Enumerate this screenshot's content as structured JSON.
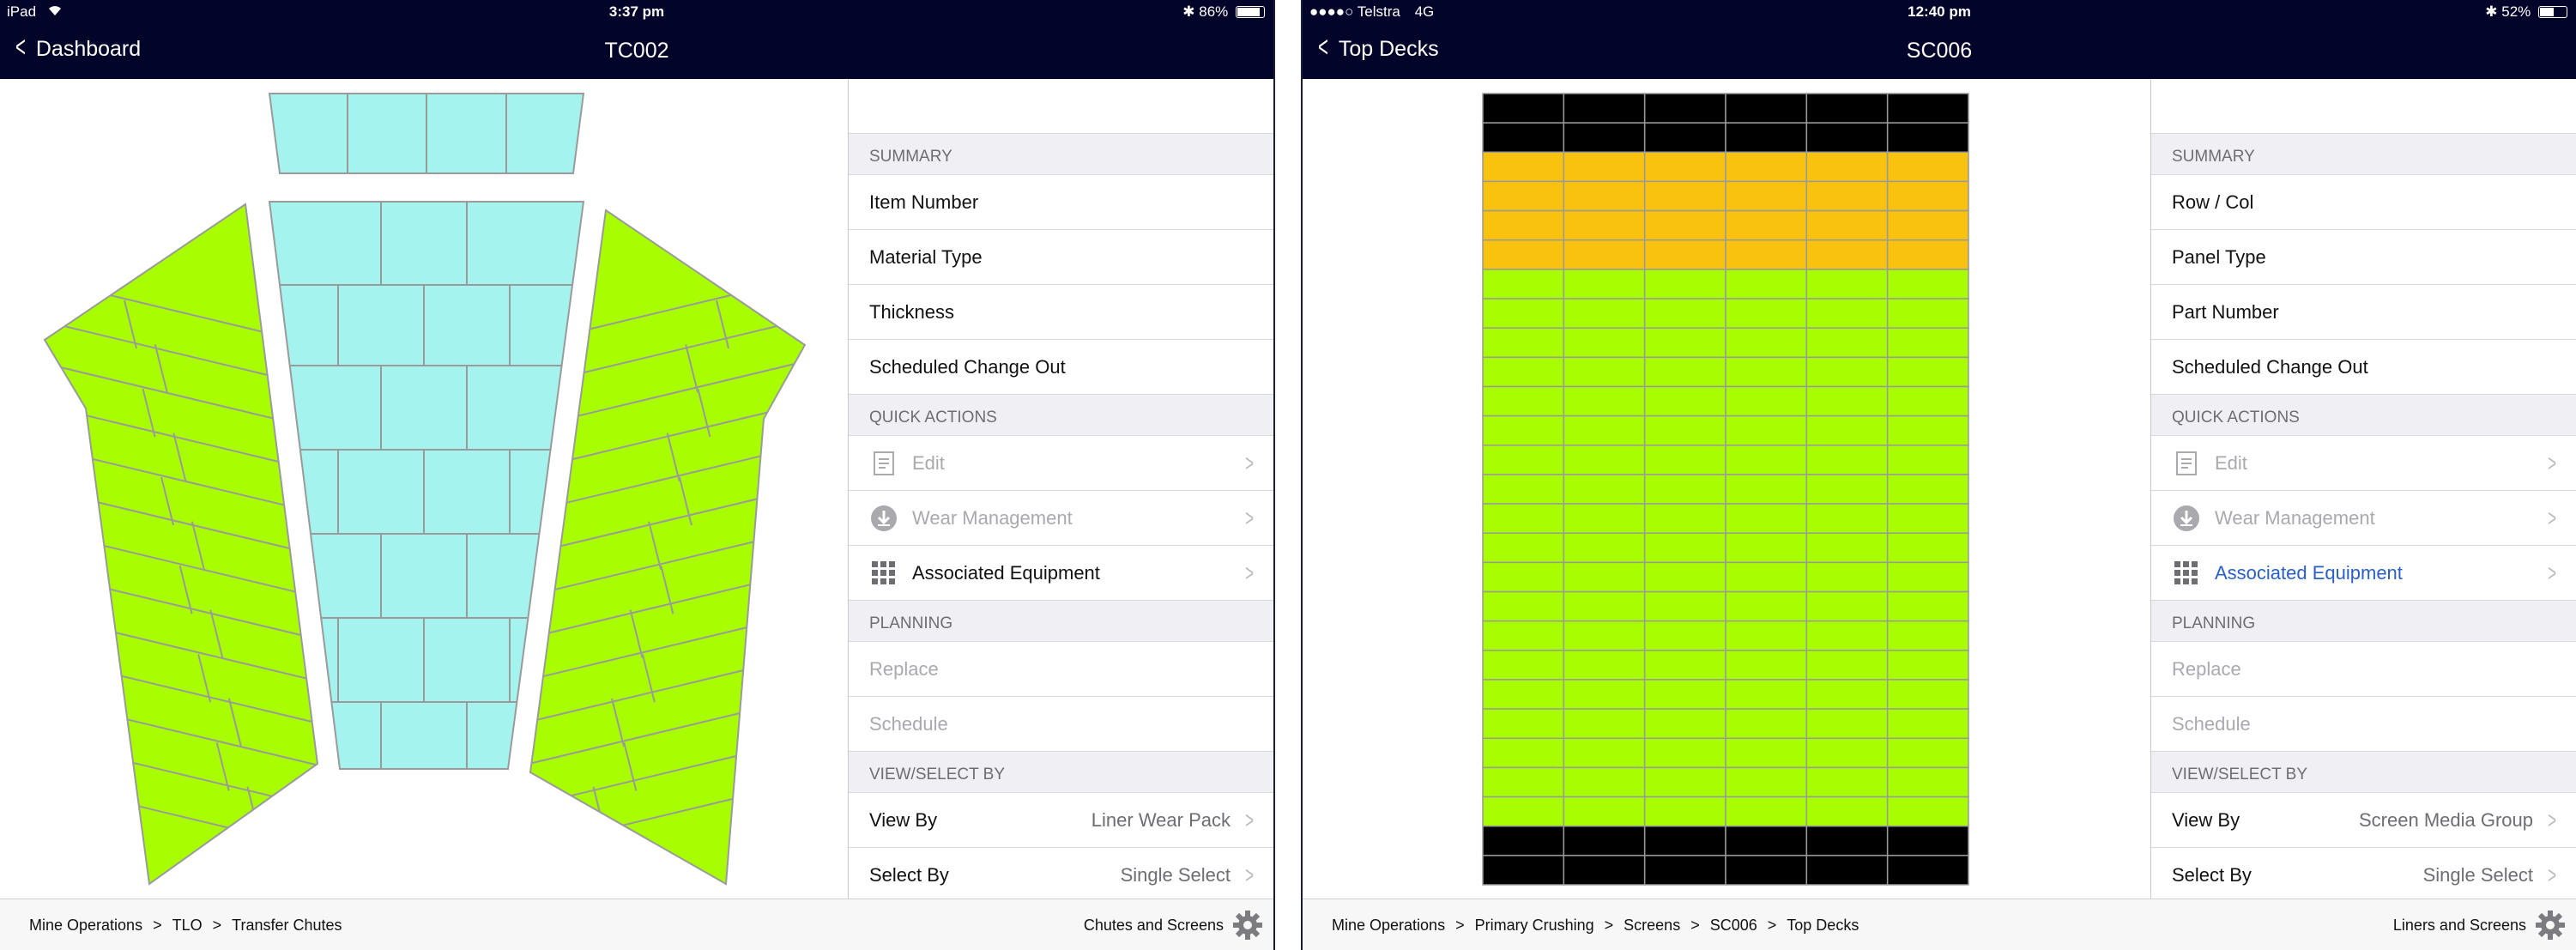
{
  "left": {
    "status": {
      "device": "iPad",
      "time": "3:37 pm",
      "battery": "86%",
      "battery_level": 0.86
    },
    "nav": {
      "back_label": "Dashboard",
      "title": "TC002"
    },
    "summary": {
      "header": "SUMMARY",
      "rows": [
        "Item Number",
        "Material Type",
        "Thickness",
        "Scheduled Change Out"
      ]
    },
    "quick_actions": {
      "header": "QUICK ACTIONS",
      "edit": "Edit",
      "wear": "Wear Management",
      "associated": "Associated Equipment"
    },
    "planning": {
      "header": "PLANNING",
      "replace": "Replace",
      "schedule": "Schedule"
    },
    "view_select": {
      "header": "VIEW/SELECT BY",
      "view_by_label": "View By",
      "view_by_value": "Liner Wear Pack",
      "select_by_label": "Select By",
      "select_by_value": "Single Select"
    },
    "footer": {
      "crumbs": [
        "Mine Operations",
        "TLO",
        "Transfer Chutes"
      ],
      "separator": ">",
      "context": "Chutes and Screens"
    },
    "colors": {
      "green": "#a8fd00",
      "cyan": "#a5f3ee"
    }
  },
  "right": {
    "status": {
      "carrier": "●●●●○ Telstra",
      "network": "4G",
      "time": "12:40 pm",
      "battery": "52%",
      "battery_level": 0.52
    },
    "nav": {
      "back_label": "Top Decks",
      "title": "SC006"
    },
    "summary": {
      "header": "SUMMARY",
      "rows": [
        "Row / Col",
        "Panel Type",
        "Part Number",
        "Scheduled Change Out"
      ]
    },
    "quick_actions": {
      "header": "QUICK ACTIONS",
      "edit": "Edit",
      "wear": "Wear Management",
      "associated": "Associated Equipment"
    },
    "planning": {
      "header": "PLANNING",
      "replace": "Replace",
      "schedule": "Schedule"
    },
    "view_select": {
      "header": "VIEW/SELECT BY",
      "view_by_label": "View By",
      "view_by_value": "Screen Media Group",
      "select_by_label": "Select By",
      "select_by_value": "Single Select"
    },
    "footer": {
      "crumbs": [
        "Mine Operations",
        "Primary Crushing",
        "Screens",
        "SC006",
        "Top Decks"
      ],
      "separator": ">",
      "context": "Liners and Screens"
    },
    "grid": {
      "columns": 6,
      "rows": 27,
      "row_colors": [
        "black",
        "black",
        "orange",
        "orange",
        "orange",
        "orange",
        "green",
        "green",
        "green",
        "green",
        "green",
        "green",
        "green",
        "green",
        "green",
        "green",
        "green",
        "green",
        "green",
        "green",
        "green",
        "green",
        "green",
        "green",
        "green",
        "black",
        "black"
      ]
    },
    "colors": {
      "black": "#000000",
      "orange": "#f8c20f",
      "green": "#a8fd00"
    }
  }
}
